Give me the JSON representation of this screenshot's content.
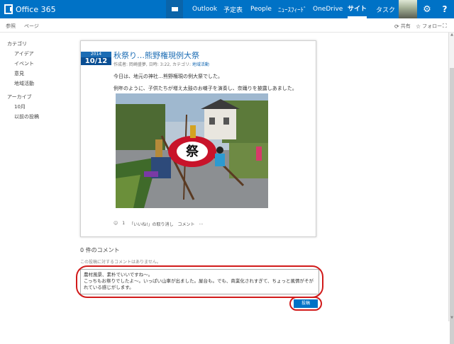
{
  "suitebar": {
    "brand": "Office 365",
    "nav": [
      "Outlook",
      "予定表",
      "People",
      "ﾆｭｰｽﾌｨｰﾄﾞ",
      "OneDrive",
      "サイト",
      "タスク"
    ],
    "active": "サイト",
    "bg_color": "#0072c6"
  },
  "ribbon": {
    "tabs": [
      "参照",
      "ページ"
    ],
    "share": "共有",
    "follow": "フォロー"
  },
  "leftnav": {
    "categories_heading": "カテゴリ",
    "categories": [
      "アイデア",
      "イベント",
      "意見",
      "地域活動"
    ],
    "archive_heading": "アーカイブ",
    "archive": [
      "10月",
      "以前の投稿"
    ]
  },
  "post": {
    "year": "2014",
    "month_day": "10/12",
    "title": "秋祭り…熊野権現例大祭",
    "meta_prefix": "作成者: 岡崎盛夢, 日時: 3:22, カテゴリ:",
    "meta_category": "地域活動",
    "paragraph1": "今日は、地元の神社…熊野権現の例大祭でした。",
    "paragraph2": "例年のように、子供たちが増え太鼓のお囃子を演奏し、奈踊りを披露しあました。",
    "photo_text": "祭",
    "like_count": "1",
    "like_label": "「いいね!」の取り消し",
    "comment_label": "コメント",
    "more": "…"
  },
  "comments": {
    "count_label": "0 件のコメント",
    "none_label": "この投稿に対するコメントはありません。",
    "input_text": "農村風景、素朴でいいですね〜。\nこっちもお祭りでしたよ〜。いっぱい山車が出ました。屋台も。でも、商業化されすぎて、ちょっと風情がそがれている感じがします。",
    "post_button": "投稿"
  }
}
